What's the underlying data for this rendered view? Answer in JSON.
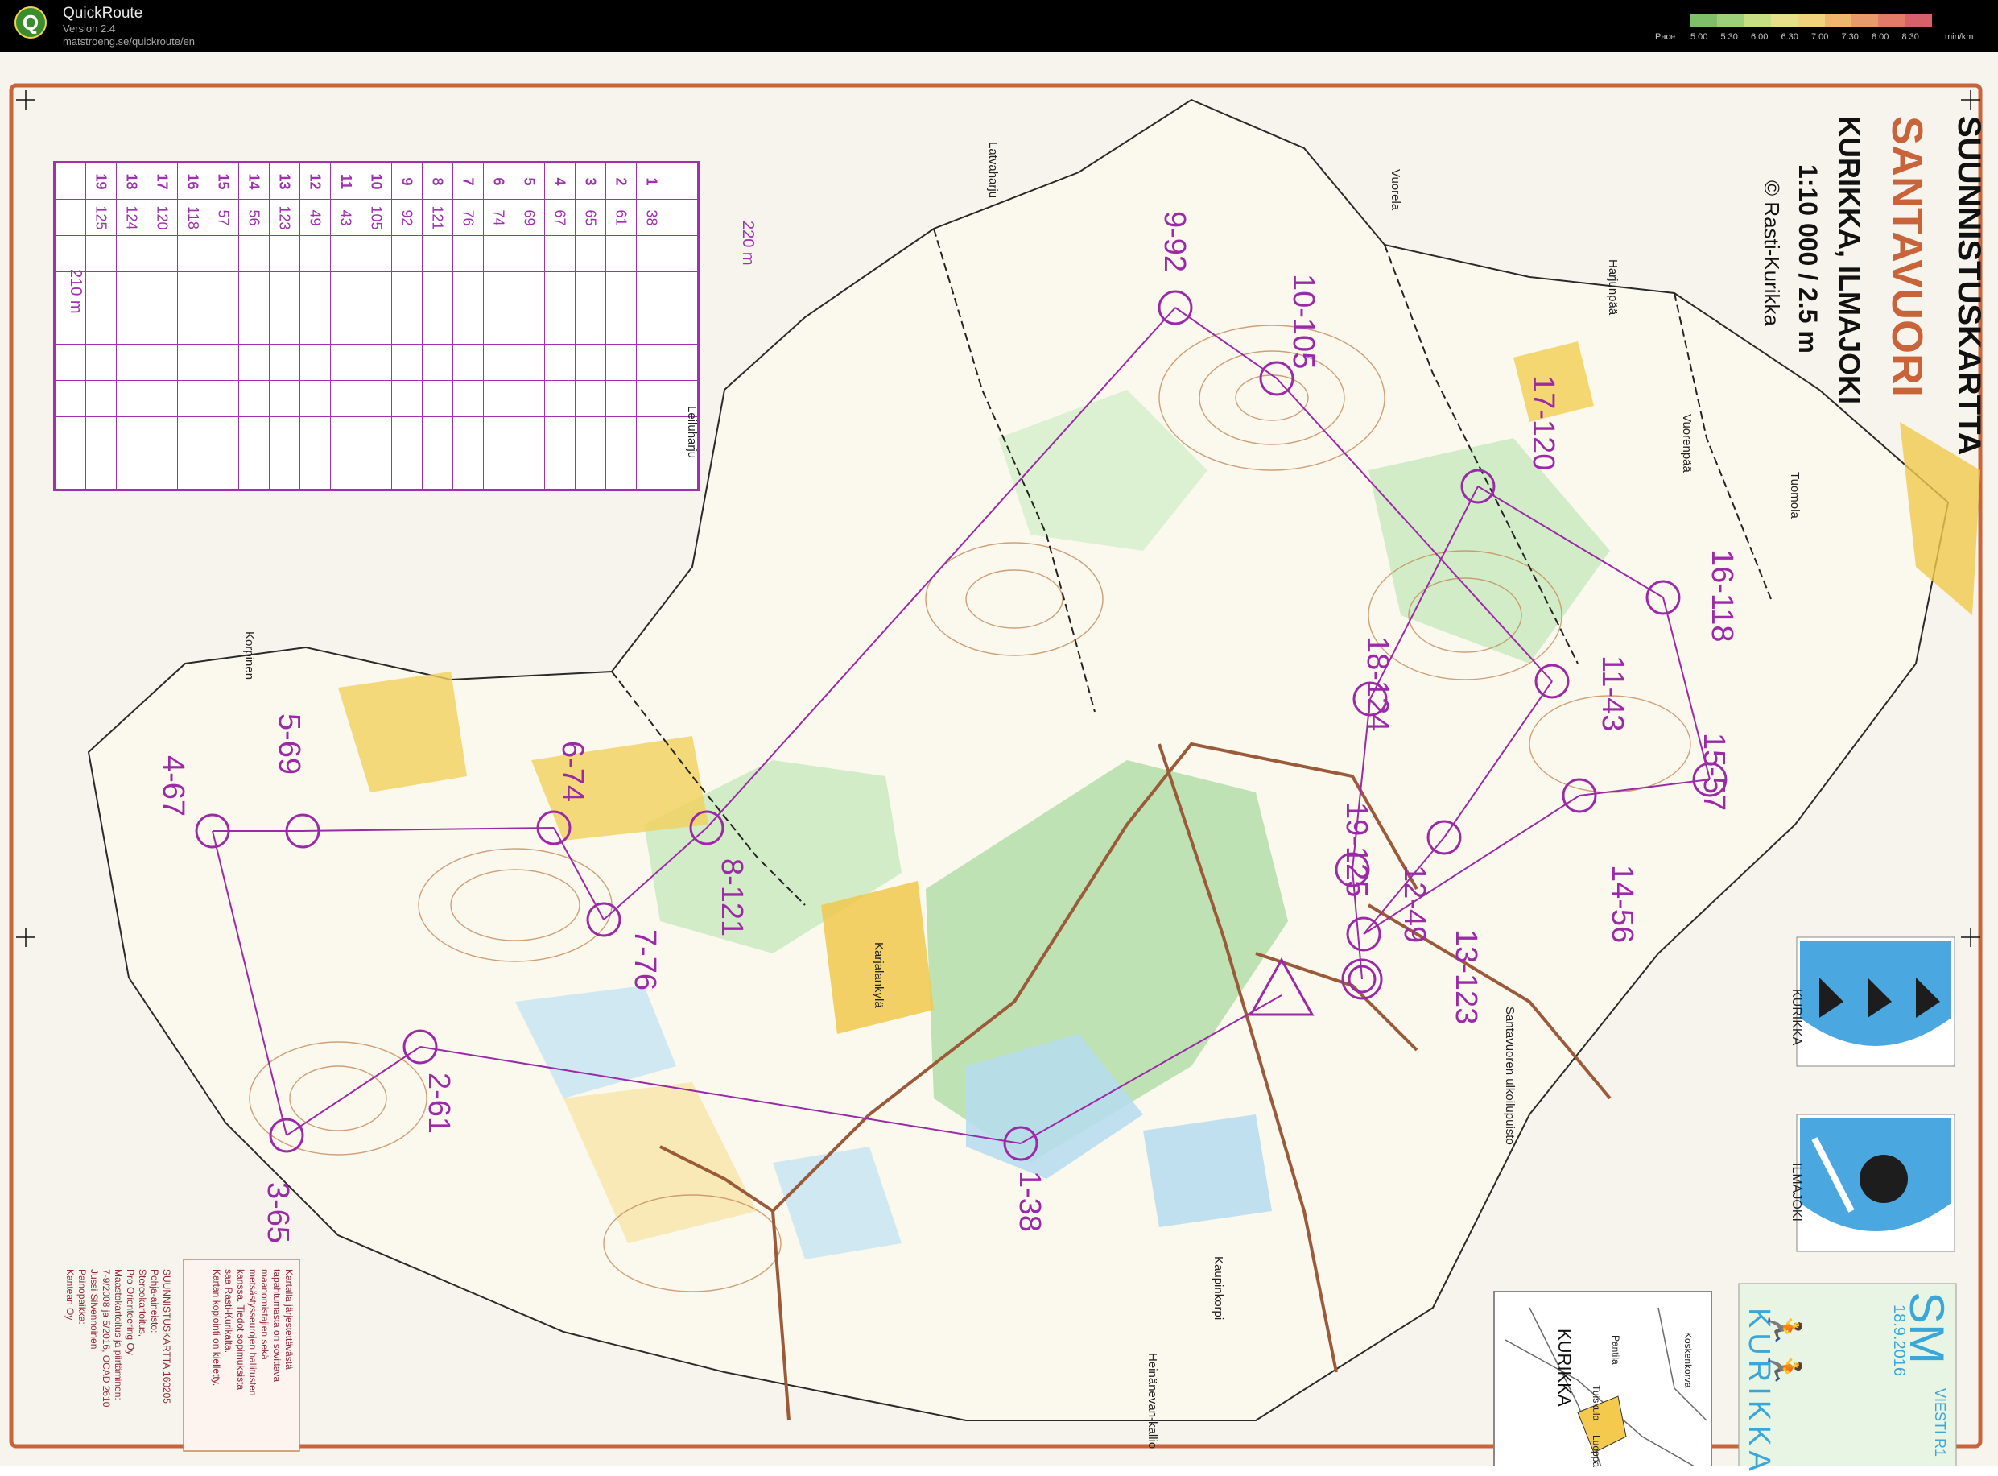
{
  "app": {
    "name": "QuickRoute",
    "version": "Version 2.4",
    "url": "matstroeng.se/quickroute/en"
  },
  "pace_scale": {
    "label": "Pace",
    "unit": "min/km",
    "ticks": [
      "5:00",
      "5:30",
      "6:00",
      "6:30",
      "7:00",
      "7:30",
      "8:00",
      "8:30"
    ],
    "colors": [
      "#7fbf6a",
      "#9cd07a",
      "#c6de84",
      "#e6e08a",
      "#f2d27c",
      "#efb66e",
      "#e79a6a",
      "#e27c68",
      "#d8606a"
    ]
  },
  "map": {
    "title": "SUUNNISTUSKARTTA",
    "name": "SANTAVUORI",
    "location": "KURIKKA, ILMAJOKI",
    "scale": "1:10 000 / 2.5 m",
    "copyright": "© Rasti-Kurikka",
    "colors": {
      "course": "#9b2aa6",
      "border": "#c9643a"
    },
    "controls": [
      {
        "label": "1-38"
      },
      {
        "label": "2-61"
      },
      {
        "label": "3-65"
      },
      {
        "label": "4-67"
      },
      {
        "label": "5-69"
      },
      {
        "label": "6-74"
      },
      {
        "label": "7-76"
      },
      {
        "label": "8-121"
      },
      {
        "label": "9-92"
      },
      {
        "label": "10-105"
      },
      {
        "label": "11-43"
      },
      {
        "label": "12-49"
      },
      {
        "label": "13-123"
      },
      {
        "label": "14-56"
      },
      {
        "label": "15-57"
      },
      {
        "label": "16-118"
      },
      {
        "label": "17-120"
      },
      {
        "label": "18-124"
      },
      {
        "label": "19-125"
      }
    ],
    "places": [
      {
        "name": "Latvaharju"
      },
      {
        "name": "Vuorela"
      },
      {
        "name": "Harjunpää"
      },
      {
        "name": "Vuorenpää"
      },
      {
        "name": "Tuomola"
      },
      {
        "name": "Leiluharju"
      },
      {
        "name": "Korpinen"
      },
      {
        "name": "Karjalankylä"
      },
      {
        "name": "Santavuoren ulkoilupuisto"
      },
      {
        "name": "Kaupinkorpi"
      },
      {
        "name": "Heinänevan-kallio"
      }
    ],
    "description_sheet": {
      "length_top": "220 m",
      "length_bottom": "210 m",
      "rows": [
        [
          "1",
          "38"
        ],
        [
          "2",
          "61"
        ],
        [
          "3",
          "65"
        ],
        [
          "4",
          "67"
        ],
        [
          "5",
          "69"
        ],
        [
          "6",
          "74"
        ],
        [
          "7",
          "76"
        ],
        [
          "8",
          "121"
        ],
        [
          "9",
          "92"
        ],
        [
          "10",
          "105"
        ],
        [
          "11",
          "43"
        ],
        [
          "12",
          "49"
        ],
        [
          "13",
          "123"
        ],
        [
          "14",
          "56"
        ],
        [
          "15",
          "57"
        ],
        [
          "16",
          "118"
        ],
        [
          "17",
          "120"
        ],
        [
          "18",
          "124"
        ],
        [
          "19",
          "125"
        ]
      ]
    },
    "logos": {
      "kurikka": "KURIKKA",
      "ilmajoki": "ILMAJOKI",
      "event_sm": "SM",
      "event_date": "18.9.2016",
      "event_type": "VIESTI R1",
      "event_place": "KURIKKA"
    },
    "credits": [
      "SUUNNISTUSKARTTA 160205",
      "Pohja-aineisto:",
      "Stereokartoitus,",
      "Pro Orienteering Oy",
      "Maastokartoitus ja piirtäminen:",
      "7-9/2008 ja 5/2016, OCAD 2610",
      "Jussi Silvennoinen",
      "Painopaikka:",
      "Kantean Oy"
    ],
    "notice": [
      "Kartalla järjestettävästä",
      "tapahtumasta on sovittava",
      "maanomistajien sekä",
      "metsästysseurojen hallitusten",
      "kanssa. Tiedot sopimuksista",
      "saa Rasti-Kurikalta.",
      "Kartan kopiointi on kielletty."
    ],
    "inset": {
      "title": "KURIKKA",
      "names": [
        "Pantila",
        "Koskenkorva",
        "Tuiskula",
        "Luoppa"
      ]
    }
  }
}
